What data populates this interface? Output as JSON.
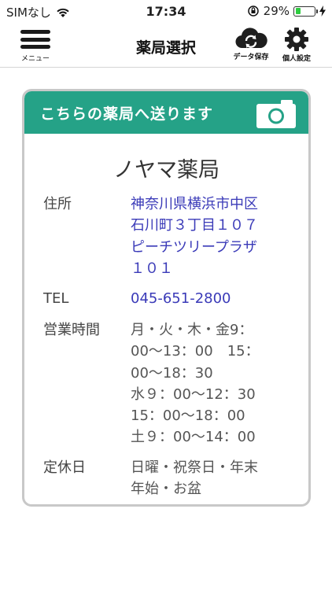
{
  "status_bar": {
    "carrier": "SIMなし",
    "time": "17:34",
    "battery_percent": "29%",
    "battery_level": 0.29
  },
  "nav": {
    "menu_label": "メニュー",
    "title": "薬局選択",
    "data_save_label": "データ保存",
    "settings_label": "個人設定"
  },
  "card": {
    "send_label": "こちらの薬局へ送ります",
    "pharmacy_name": "ノヤマ薬局",
    "address_label": "住所",
    "address_lines": [
      "神奈川県横浜市中区",
      "石川町３丁目１０７",
      "ピーチツリープラザ",
      "１０１"
    ],
    "tel_label": "TEL",
    "tel_value": "045-651-2800",
    "hours_label": "営業時間",
    "hours_lines": [
      "月・火・木・金9：",
      "00〜13：00　15：",
      "00〜18：30",
      "水９：00〜12：30",
      "15：00〜18：00",
      "土９：00〜14：00"
    ],
    "holiday_label": "定休日",
    "holiday_lines": [
      "日曜・祝祭日・年末",
      "年始・お盆"
    ]
  },
  "colors": {
    "accent_green": "#25a287",
    "link_blue": "#3a3ab8"
  }
}
